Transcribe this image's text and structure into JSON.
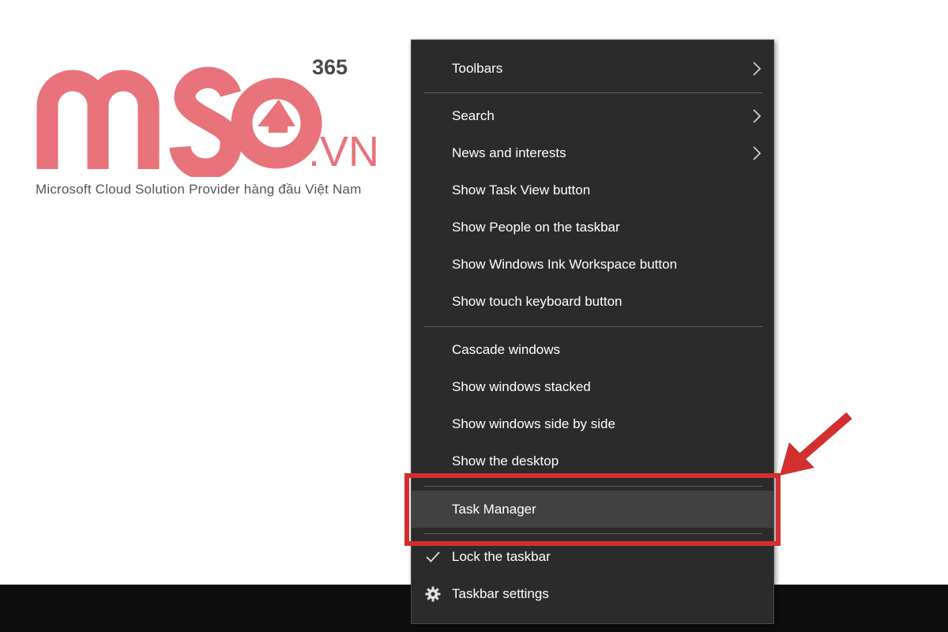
{
  "logo": {
    "brand": "MSO",
    "superscript": "365",
    "suffix": ".VN",
    "tagline": "Microsoft Cloud Solution Provider hàng đầu Việt Nam",
    "color": "#e8737a",
    "superscript_color": "#4a4a4a"
  },
  "context_menu": {
    "items": [
      {
        "label": "Toolbars",
        "submenu": true
      },
      {
        "label": "Search",
        "submenu": true
      },
      {
        "label": "News and interests",
        "submenu": true
      },
      {
        "label": "Show Task View button"
      },
      {
        "label": "Show People on the taskbar"
      },
      {
        "label": "Show Windows Ink Workspace button"
      },
      {
        "label": "Show touch keyboard button"
      },
      {
        "label": "Cascade windows"
      },
      {
        "label": "Show windows stacked"
      },
      {
        "label": "Show windows side by side"
      },
      {
        "label": "Show the desktop"
      },
      {
        "label": "Task Manager",
        "highlighted": true
      },
      {
        "label": "Lock the taskbar",
        "checked": true,
        "icon": "check-icon"
      },
      {
        "label": "Taskbar settings",
        "icon": "gear-icon"
      }
    ],
    "background": "#2b2b2b",
    "text_color": "#ffffff"
  },
  "annotation": {
    "color": "#d22f2f",
    "target": "Task Manager"
  }
}
